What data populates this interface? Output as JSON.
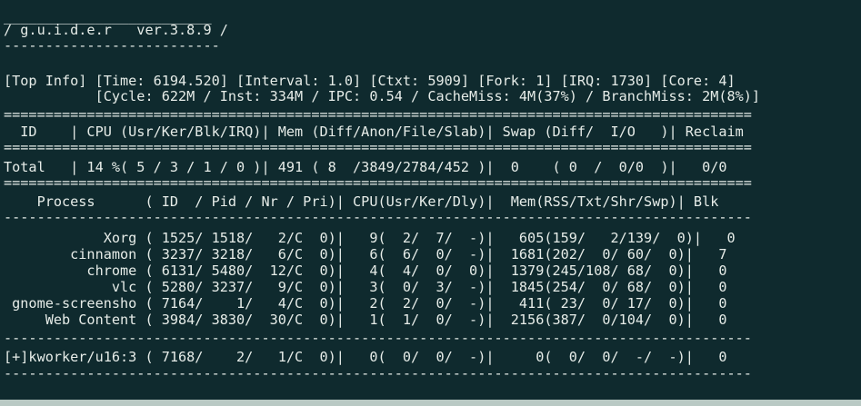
{
  "window": {
    "background_color": "#0f2a2e",
    "text_color": "#e6ece8"
  },
  "logo": {
    "top_rule": "_________________________",
    "title": "/ g.u.i.d.e.r   ver.3.8.9 /",
    "bottom_rule": "--------------------------"
  },
  "top_info": {
    "line1": "[Top Info] [Time: 6194.520] [Interval: 1.0] [Ctxt: 5909] [Fork: 1] [IRQ: 1730] [Core: 4]",
    "line2": "           [Cycle: 622M / Inst: 334M / IPC: 0.54 / CacheMiss: 4M(37%) / BranchMiss: 2M(8%)]"
  },
  "separators": {
    "double": "==========================================================================================",
    "single": "------------------------------------------------------------------------------------------"
  },
  "summary": {
    "header": "  ID    | CPU (Usr/Ker/Blk/IRQ)| Mem (Diff/Anon/File/Slab)| Swap (Diff/  I/O   )| Reclaim",
    "total": "Total   | 14 %( 5 / 3 / 1 / 0 )| 491 ( 8  /3849/2784/452 )|  0    ( 0  /  0/0  )|   0/0"
  },
  "process_table": {
    "header": "    Process      ( ID  / Pid / Nr / Pri)| CPU(Usr/Ker/Dly)|  Mem(RSS/Txt/Shr/Swp)| Blk",
    "rows": [
      "            Xorg ( 1525/ 1518/   2/C  0)|   9(  2/  7/  -)|   605(159/   2/139/  0)|   0",
      "        cinnamon ( 3237/ 3218/   6/C  0)|   6(  6/  0/  -)|  1681(202/  0/ 60/  0)|   7",
      "          chrome ( 6131/ 5480/  12/C  0)|   4(  4/  0/  0)|  1379(245/108/ 68/  0)|   0",
      "             vlc ( 5280/ 3237/   9/C  0)|   3(  0/  3/  -)|  1845(254/  0/ 68/  0)|   0",
      " gnome-screensho ( 7164/    1/   4/C  0)|   2(  2/  0/  -)|   411( 23/  0/ 17/  0)|   0",
      "     Web Content ( 3984/ 3830/  30/C  0)|   1(  1/  0/  -)|  2156(387/  0/104/  0)|   0"
    ],
    "kworker": "[+]kworker/u16:3 ( 7168/    2/   1/C  0)|   0(  0/  0/  -)|     0(  0/  0/  -/  -)|   0"
  }
}
